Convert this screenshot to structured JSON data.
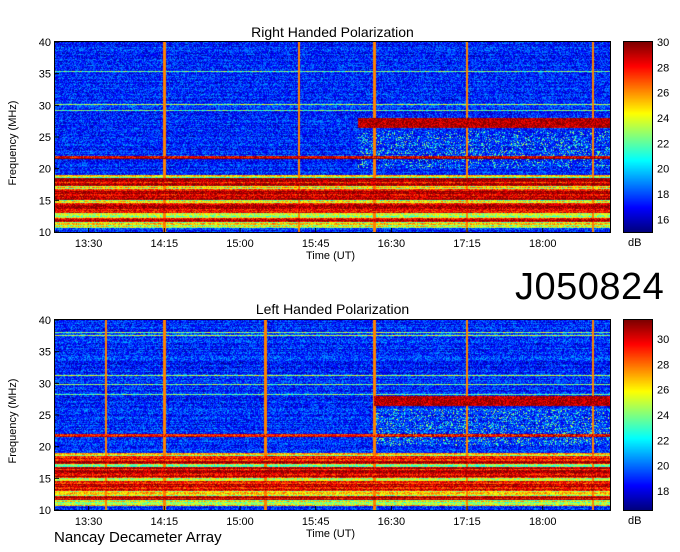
{
  "observation_id": "J050824",
  "instrument": "Nancay Decameter Array",
  "chart_data": [
    {
      "type": "heatmap",
      "title": "Right Handed Polarization",
      "xlabel": "Time (UT)",
      "ylabel": "Frequency (MHz)",
      "xticks": [
        "13:30",
        "14:15",
        "15:00",
        "15:45",
        "16:30",
        "17:15",
        "18:00"
      ],
      "yticks": [
        10,
        15,
        20,
        25,
        30,
        35,
        40
      ],
      "ylim": [
        10,
        40
      ],
      "xlim": [
        "13:10",
        "18:40"
      ],
      "colorbar": {
        "label": "dB",
        "ticks": [
          16,
          18,
          20,
          22,
          24,
          26,
          28,
          30
        ],
        "range": [
          15,
          30
        ]
      },
      "colormap": "jet",
      "strong_bands_mhz": [
        [
          11.5,
          12.2
        ],
        [
          13.0,
          14.5
        ],
        [
          15.0,
          16.8
        ],
        [
          17.2,
          18.5
        ],
        [
          21.5,
          22.0
        ]
      ],
      "late_emission_band": {
        "start": "16:10",
        "freq_mhz": [
          26.5,
          28.0
        ]
      },
      "vertical_lines": [
        "14:15",
        "15:35",
        "16:20",
        "17:15",
        "18:30"
      ]
    },
    {
      "type": "heatmap",
      "title": "Left Handed Polarization",
      "xlabel": "Time (UT)",
      "ylabel": "Frequency (MHz)",
      "xticks": [
        "13:30",
        "14:15",
        "15:00",
        "15:45",
        "16:30",
        "17:15",
        "18:00"
      ],
      "yticks": [
        10,
        15,
        20,
        25,
        30,
        35,
        40
      ],
      "ylim": [
        10,
        40
      ],
      "xlim": [
        "13:10",
        "18:40"
      ],
      "colorbar": {
        "label": "dB",
        "ticks": [
          18,
          20,
          22,
          24,
          26,
          28,
          30
        ],
        "range": [
          16.5,
          31.5
        ]
      },
      "colormap": "jet",
      "strong_bands_mhz": [
        [
          11.5,
          12.2
        ],
        [
          13.0,
          14.5
        ],
        [
          15.0,
          16.8
        ],
        [
          17.2,
          18.5
        ],
        [
          21.5,
          22.0
        ]
      ],
      "late_emission_band": {
        "start": "16:20",
        "freq_mhz": [
          26.5,
          28.0
        ]
      },
      "vertical_lines": [
        "13:40",
        "14:15",
        "15:15",
        "16:20",
        "17:15",
        "18:30"
      ]
    }
  ]
}
